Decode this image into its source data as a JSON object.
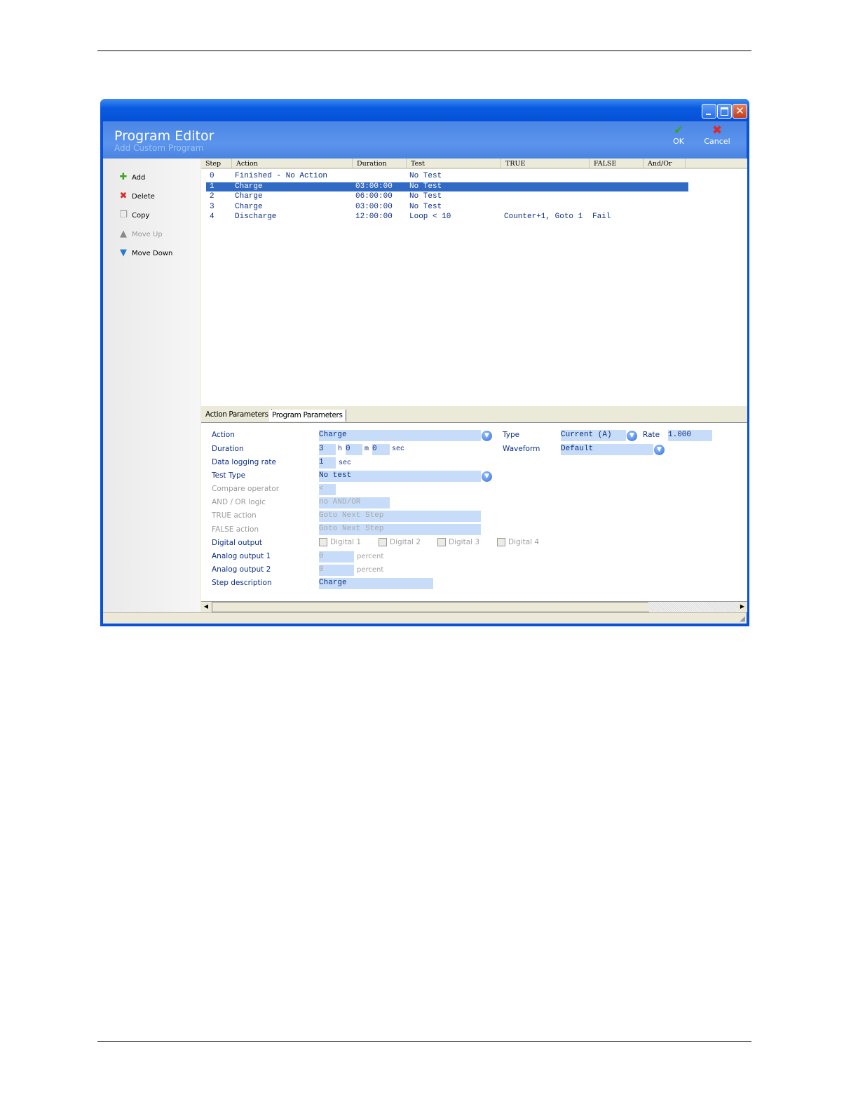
{
  "window": {
    "controls": [
      "minimize",
      "maximize",
      "close"
    ]
  },
  "header": {
    "title": "Program Editor",
    "subtitle": "Add Custom Program",
    "ok_label": "OK",
    "cancel_label": "Cancel"
  },
  "sidebar": {
    "items": [
      {
        "label": "Add",
        "icon": "plus-icon",
        "enabled": true
      },
      {
        "label": "Delete",
        "icon": "delete-x-icon",
        "enabled": true
      },
      {
        "label": "Copy",
        "icon": "copy-icon",
        "enabled": true
      },
      {
        "label": "Move Up",
        "icon": "arrow-up-icon",
        "enabled": false
      },
      {
        "label": "Move Down",
        "icon": "arrow-down-icon",
        "enabled": true
      }
    ]
  },
  "grid": {
    "columns": [
      "Step",
      "Action",
      "Duration",
      "Test",
      "TRUE",
      "FALSE",
      "And/Or"
    ],
    "rows": [
      [
        "0",
        "Finished - No Action",
        "",
        "No Test",
        "",
        "",
        ""
      ],
      [
        "1",
        "Charge",
        "03:00:00",
        "No Test",
        "",
        "",
        ""
      ],
      [
        "2",
        "Charge",
        "06:00:00",
        "No Test",
        "",
        "",
        ""
      ],
      [
        "3",
        "Charge",
        "03:00:00",
        "No Test",
        "",
        "",
        ""
      ],
      [
        "4",
        "Discharge",
        "12:00:00",
        "Loop < 10",
        "Counter+1, Goto 1",
        "Fail",
        ""
      ]
    ],
    "selected_row": 1
  },
  "tabs": [
    {
      "label": "Action Parameters",
      "active": true
    },
    {
      "label": "Program Parameters",
      "active": false
    }
  ],
  "form": {
    "action": {
      "label": "Action",
      "value": "Charge"
    },
    "duration": {
      "label": "Duration",
      "h": "3",
      "h_unit": "h",
      "m": "0",
      "m_unit": "m",
      "s": "0",
      "s_unit": "sec"
    },
    "logging": {
      "label": "Data logging rate",
      "value": "1",
      "unit": "sec"
    },
    "test_type": {
      "label": "Test Type",
      "value": "No test"
    },
    "compare": {
      "label": "Compare operator",
      "value": "<"
    },
    "andor": {
      "label": "AND / OR logic",
      "value": "no AND/OR"
    },
    "true_action": {
      "label": "TRUE action",
      "value": "Goto Next Step"
    },
    "false_action": {
      "label": "FALSE action",
      "value": "Goto Next Step"
    },
    "digital": {
      "label": "Digital output",
      "options": [
        "Digital 1",
        "Digital 2",
        "Digital 3",
        "Digital 4"
      ]
    },
    "analog1": {
      "label": "Analog output 1",
      "value": "0",
      "unit": "percent"
    },
    "analog2": {
      "label": "Analog output 2",
      "value": "0",
      "unit": "percent"
    },
    "step_desc": {
      "label": "Step description",
      "value": "Charge"
    },
    "type": {
      "label": "Type",
      "value": "Current (A)"
    },
    "rate": {
      "label": "Rate",
      "value": "1.000"
    },
    "waveform": {
      "label": "Waveform",
      "value": "Default"
    }
  },
  "colors": {
    "title_blue": "#0a52d8",
    "selection": "#316ac5",
    "input_bg": "#c7dcf8",
    "text_blue": "#0b2f86"
  }
}
